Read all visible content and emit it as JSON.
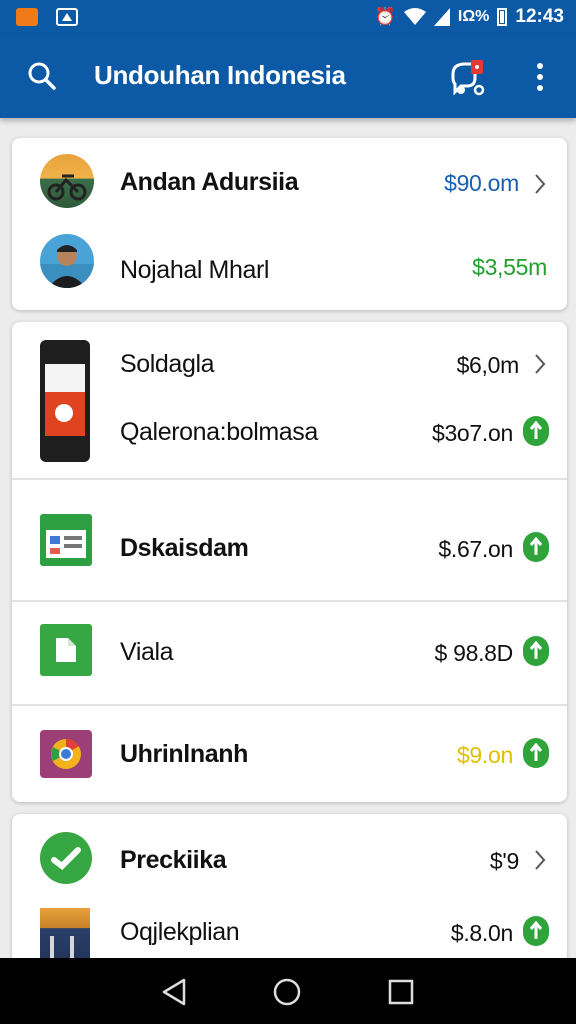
{
  "status_bar": {
    "time": "12:43",
    "battery_percent_text": "ΙΩ%",
    "icons": [
      "alarm-icon",
      "wifi-icon",
      "signal-icon",
      "battery-icon"
    ],
    "notification_icons": [
      "app-notification-icon",
      "drive-notification-icon"
    ]
  },
  "app_bar": {
    "title": "Undouhan Indonesia",
    "icons": [
      "search-icon",
      "tag-alert-icon",
      "more-vert-icon"
    ],
    "color": "#0c5aa6"
  },
  "cards": [
    {
      "rows": [
        {
          "name": "Andan Adursiia",
          "amount": "$90.om",
          "amount_color": "#1a5fae",
          "trailing": "chevron",
          "thumbnail": "motorcycle-avatar"
        },
        {
          "name": "Nojahal Mharl",
          "amount": "$3,55m",
          "amount_color": "#23a02a",
          "trailing": "none",
          "thumbnail": "person-avatar"
        }
      ]
    },
    {
      "rows": [
        {
          "name": "Soldagla",
          "amount": "$6,0m",
          "trailing": "chevron",
          "thumbnail": "phone-thumbnail"
        },
        {
          "name": "Qaleronа:bolmasa",
          "amount": "$3o7.on",
          "trailing": "up-badge"
        },
        {
          "name": "Dskaisdam",
          "amount": "$.67.on",
          "trailing": "up-badge",
          "thumbnail": "sheets-icon"
        },
        {
          "name": "Viala",
          "amount": "$ 98.8D",
          "trailing": "up-badge",
          "thumbnail": "file-icon"
        },
        {
          "name": "Uhrinlnanh",
          "amount": "$9.on",
          "amount_color": "#e0bf00",
          "trailing": "up-badge",
          "thumbnail": "chrome-icon"
        }
      ]
    },
    {
      "rows": [
        {
          "name": "Preckiika",
          "amount": "$'9",
          "trailing": "chevron",
          "thumbnail": "green-check-icon"
        },
        {
          "name": "Oqjlekplian",
          "amount": "$.8.0n",
          "trailing": "up-badge",
          "thumbnail": "building-photo"
        }
      ]
    }
  ],
  "nav_bar": {
    "icons": [
      "back-icon",
      "home-icon",
      "recents-icon"
    ]
  },
  "colors": {
    "primary": "#0c5aa6",
    "green": "#2ea43a",
    "background": "#ececec"
  }
}
